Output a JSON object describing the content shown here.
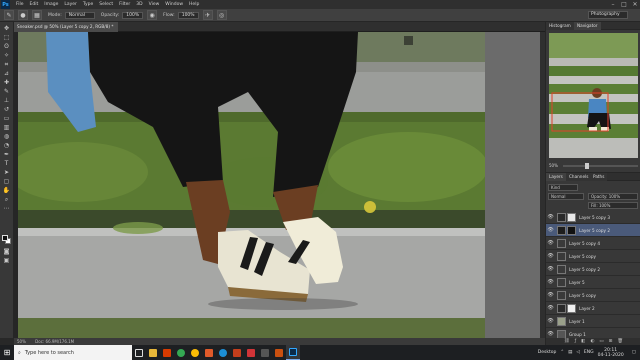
{
  "app": {
    "logo": "Ps",
    "menus": [
      "File",
      "Edit",
      "Image",
      "Layer",
      "Type",
      "Select",
      "Filter",
      "3D",
      "View",
      "Window",
      "Help"
    ],
    "window_controls": {
      "minimize": "–",
      "maximize": "□",
      "close": "✕"
    }
  },
  "options_bar": {
    "mode_label": "Mode:",
    "mode_value": "Normal",
    "opacity_label": "Opacity:",
    "opacity_value": "100%",
    "flow_label": "Flow:",
    "flow_value": "100%",
    "workspace": "Photography"
  },
  "document": {
    "tab_title": "Sneaker.psd @ 50% (Layer 5 copy 2, RGB/8) *",
    "zoom": "50%",
    "doc_info": "Doc: 66.9M/176.1M"
  },
  "navigator": {
    "tabs": [
      "Histogram",
      "Navigator"
    ],
    "zoom": "50%"
  },
  "layers": {
    "tabs": [
      "Layers",
      "Channels",
      "Paths"
    ],
    "kind_filter": "Kind",
    "blend_mode": "Normal",
    "opacity_label": "Opacity: 100%",
    "fill_label": "Fill: 100%",
    "items": [
      {
        "name": "Layer 5 copy 3",
        "thumb": "#2a2a2a",
        "mask": "#e8e8e8",
        "selected": false
      },
      {
        "name": "Layer 5 copy 2",
        "thumb": "#1e1e1e",
        "mask": "#111111",
        "selected": true
      },
      {
        "name": "Layer 5 copy 4",
        "thumb": "#3a3a3a",
        "mask": "",
        "selected": false
      },
      {
        "name": "Layer 5 copy",
        "thumb": "#3a3a3a",
        "mask": "",
        "selected": false
      },
      {
        "name": "Layer 5 copy 2",
        "thumb": "#3a3a3a",
        "mask": "",
        "selected": false
      },
      {
        "name": "Layer 5",
        "thumb": "#3a3a3a",
        "mask": "",
        "selected": false
      },
      {
        "name": "Layer 5 copy",
        "thumb": "#3a3a3a",
        "mask": "",
        "selected": false
      },
      {
        "name": "Layer 2",
        "thumb": "#2a2a2a",
        "mask": "#f0f0f0",
        "selected": false
      },
      {
        "name": "Layer 1",
        "thumb": "#9aa08a",
        "mask": "",
        "selected": false
      },
      {
        "name": "Group 1",
        "thumb": "#555555",
        "mask": "",
        "selected": false
      }
    ]
  },
  "taskbar": {
    "search_placeholder": "Type here to search",
    "desktop_label": "Desktop",
    "language": "ENG",
    "time": "20:11",
    "date": "04-11-2020"
  }
}
